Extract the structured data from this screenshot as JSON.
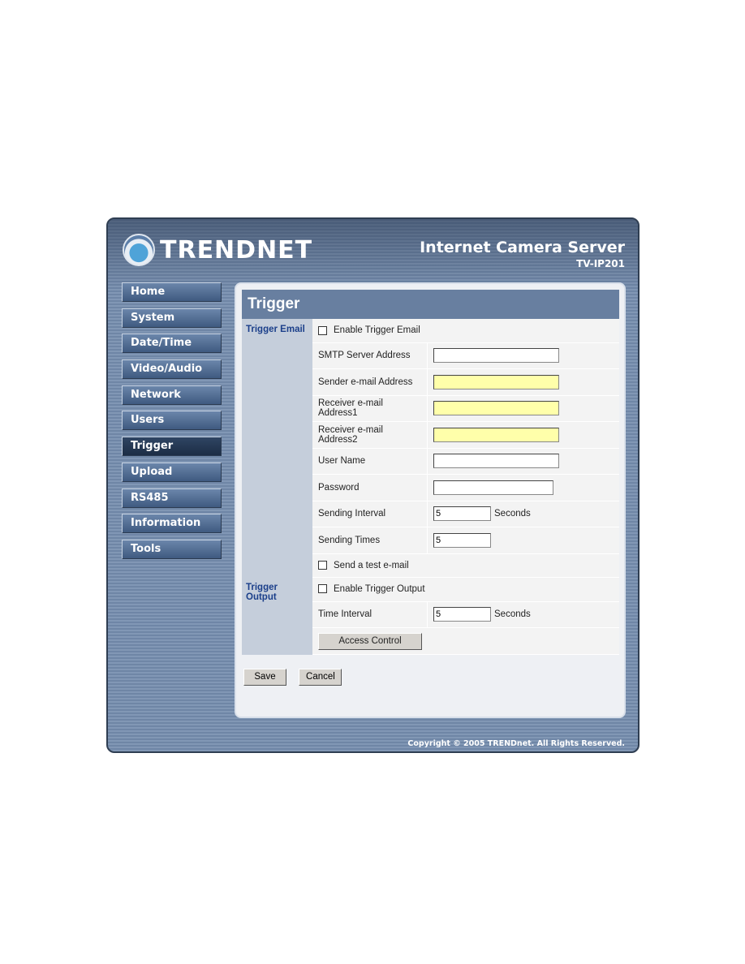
{
  "brand": {
    "logo_text": "TRENDNET",
    "product_title": "Internet Camera Server",
    "model": "TV-IP201"
  },
  "nav": [
    {
      "label": "Home"
    },
    {
      "label": "System"
    },
    {
      "label": "Date/Time"
    },
    {
      "label": "Video/Audio"
    },
    {
      "label": "Network"
    },
    {
      "label": "Users"
    },
    {
      "label": "Trigger",
      "active": true
    },
    {
      "label": "Upload"
    },
    {
      "label": "RS485"
    },
    {
      "label": "Information"
    },
    {
      "label": "Tools"
    }
  ],
  "page": {
    "title": "Trigger"
  },
  "trigger_email": {
    "section_label": "Trigger Email",
    "enable_label": "Enable Trigger Email",
    "enable_checked": false,
    "smtp_label": "SMTP Server Address",
    "smtp_value": "",
    "sender_label": "Sender e-mail Address",
    "sender_value": "",
    "receiver1_label": "Receiver e-mail Address1",
    "receiver1_value": "",
    "receiver2_label": "Receiver e-mail Address2",
    "receiver2_value": "",
    "username_label": "User Name",
    "username_value": "",
    "password_label": "Password",
    "password_value": "",
    "interval_label": "Sending Interval",
    "interval_value": "5",
    "interval_unit": "Seconds",
    "times_label": "Sending Times",
    "times_value": "5",
    "test_label": "Send a test e-mail",
    "test_checked": false,
    "required_color": "#ffffaa"
  },
  "trigger_output": {
    "section_label": "Trigger Output",
    "enable_label": "Enable Trigger Output",
    "enable_checked": false,
    "interval_label": "Time Interval",
    "interval_value": "5",
    "interval_unit": "Seconds",
    "access_control_label": "Access Control"
  },
  "actions": {
    "save": "Save",
    "cancel": "Cancel"
  },
  "footer": {
    "copyright": "Copyright © 2005 TRENDnet. All Rights Reserved."
  }
}
